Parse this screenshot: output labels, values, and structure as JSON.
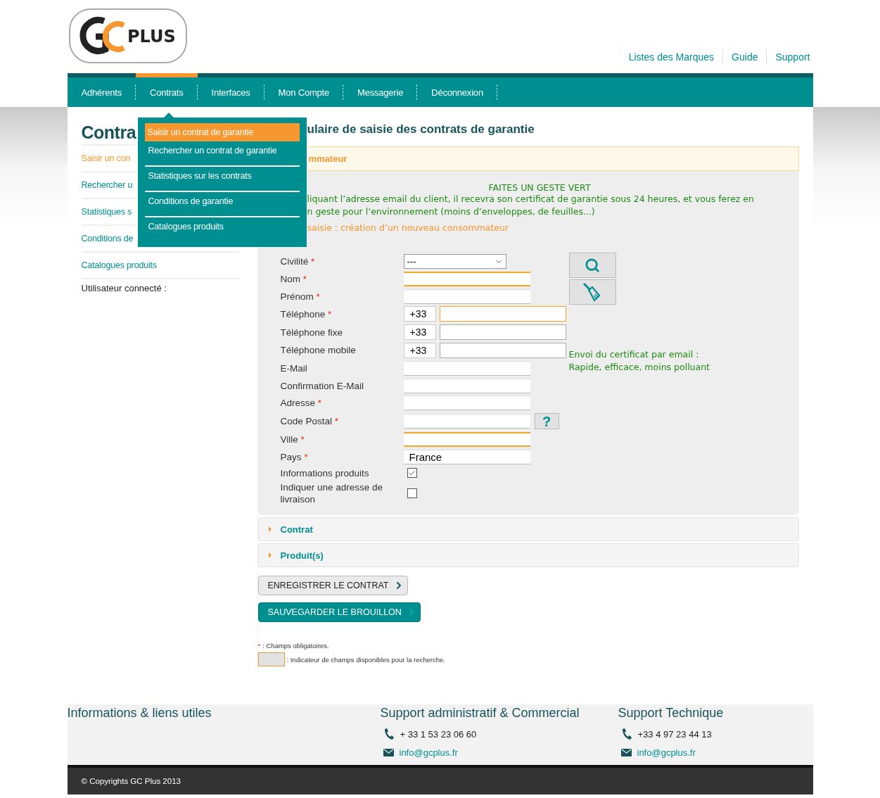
{
  "logo": {
    "text": "PLUS"
  },
  "top_links": [
    "Listes des Marques",
    "Guide",
    "Support"
  ],
  "nav": [
    {
      "label": "Adhérents",
      "selected": false
    },
    {
      "label": "Contrats",
      "selected": true
    },
    {
      "label": "Interfaces",
      "selected": false
    },
    {
      "label": "Mon Compte",
      "selected": false
    },
    {
      "label": "Messagerie",
      "selected": false
    },
    {
      "label": "Déconnexion",
      "selected": false
    }
  ],
  "dropdown": [
    {
      "label": "Saisir un contrat de garantie",
      "selected": true
    },
    {
      "label": "Rechercher un contrat de garantie",
      "selected": false
    },
    {
      "label": "Statistiques sur les contrats",
      "selected": false
    },
    {
      "label": "Conditions de garantie",
      "selected": false
    },
    {
      "label": "Catalogues produits",
      "selected": false
    }
  ],
  "sidebar": {
    "title": "Contra",
    "items": [
      {
        "label": "Saisir un con",
        "selected": true
      },
      {
        "label": "Rechercher u",
        "selected": false
      },
      {
        "label": "Statistiques s",
        "selected": false
      },
      {
        "label": "Conditions de",
        "selected": false
      },
      {
        "label": "Catalogues produits",
        "selected": false
      }
    ],
    "user_label": "Utilisateur connecté :"
  },
  "main": {
    "title": "ulaire de saisie des contrats de garantie",
    "section": {
      "title": "mmateur",
      "expanded": true
    },
    "notice": {
      "heading": "FAITES UN GESTE VERT",
      "lines": [
        "liquant l’adresse email du client, il recevra son certificat de garantie sous 24 heures, et vous ferez en",
        "n geste pour l’environnement (moins d’enveloppes, de feuilles...)"
      ]
    },
    "mode": "saisie : création d’un nouveau consommateur",
    "fields": [
      {
        "kind": "select",
        "label": "Civilité",
        "required": true,
        "searchable": false,
        "value": "---"
      },
      {
        "kind": "text",
        "label": "Nom",
        "required": true,
        "searchable": true
      },
      {
        "kind": "text",
        "label": "Prénom",
        "required": true,
        "searchable": false
      },
      {
        "kind": "phone",
        "label": "Téléphone",
        "required": true,
        "searchable": true,
        "prefix": "+33"
      },
      {
        "kind": "phone",
        "label": "Téléphone fixe",
        "required": false,
        "searchable": false,
        "prefix": "+33"
      },
      {
        "kind": "phone",
        "label": "Téléphone mobile",
        "required": false,
        "searchable": false,
        "prefix": "+33"
      },
      {
        "kind": "text",
        "label": "E-Mail",
        "required": false,
        "searchable": false
      },
      {
        "kind": "text",
        "label": "Confirmation E-Mail",
        "required": false,
        "searchable": false
      },
      {
        "kind": "text",
        "label": "Adresse",
        "required": true,
        "searchable": false
      },
      {
        "kind": "postal",
        "label": "Code Postal",
        "required": true,
        "searchable": false,
        "help": "?"
      },
      {
        "kind": "text",
        "label": "Ville",
        "required": true,
        "searchable": true
      },
      {
        "kind": "text",
        "label": "Pays",
        "required": true,
        "searchable": false,
        "value": "France"
      },
      {
        "kind": "checkbox",
        "label": "Informations produits",
        "checked": true
      },
      {
        "kind": "checkbox",
        "label": "Indiquer une adresse de livraison",
        "checked": false
      }
    ],
    "side_note": [
      "Envoi du certificat par email :",
      "Rapide, efficace, moins polluant"
    ],
    "required_mark": "*"
  },
  "sections": [
    {
      "title": "Contrat",
      "expanded": false
    },
    {
      "title": "Produit(s)",
      "expanded": false
    }
  ],
  "buttons": [
    {
      "label": "ENREGISTRER LE CONTRAT",
      "kind": "secondary"
    },
    {
      "label": "SAUVEGARDER LE BROUILLON",
      "kind": "primary"
    }
  ],
  "legend": {
    "mark": "*",
    "required_text": ": Champs obligatoires.",
    "search_text": ": Indicateur de champs disponibles pour la recherche."
  },
  "footer": {
    "columns": [
      {
        "title": "Informations & liens utiles"
      },
      {
        "title": "Support administratif & Commercial",
        "phone": "+ 33 1 53 23 06 60",
        "email": "info@gcplus.fr"
      },
      {
        "title": "Support Technique",
        "phone": "+33 4 97 23 44 13",
        "email": "info@gcplus.fr"
      }
    ],
    "copyright": "© Copyrights GC Plus 2013"
  }
}
